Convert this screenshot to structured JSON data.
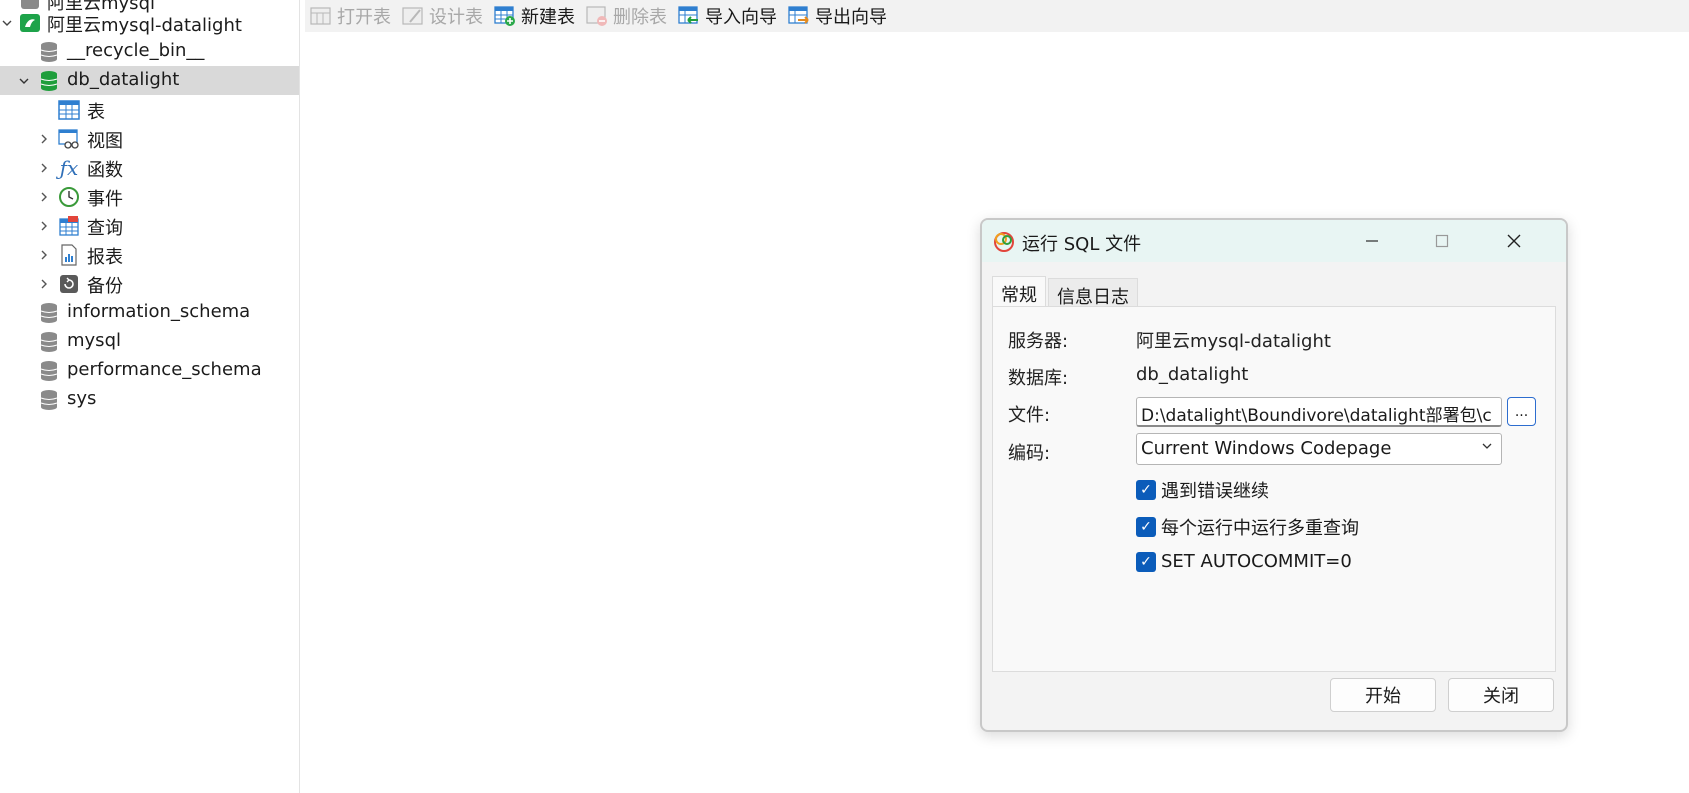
{
  "sidebar": {
    "connection_top_partial": "阿里云mysql",
    "connection": "阿里云mysql-datalight",
    "databases_before": [
      "__recycle_bin__"
    ],
    "selected_db": "db_datalight",
    "db_children": [
      "表",
      "视图",
      "函数",
      "事件",
      "查询",
      "报表",
      "备份"
    ],
    "databases_after": [
      "information_schema",
      "mysql",
      "performance_schema",
      "sys"
    ]
  },
  "toolbar": {
    "buttons": [
      {
        "label": "打开表",
        "enabled": false,
        "icon": "open-table-icon"
      },
      {
        "label": "设计表",
        "enabled": false,
        "icon": "design-table-icon"
      },
      {
        "label": "新建表",
        "enabled": true,
        "icon": "new-table-icon"
      },
      {
        "label": "删除表",
        "enabled": false,
        "icon": "delete-table-icon"
      },
      {
        "label": "导入向导",
        "enabled": true,
        "icon": "import-wizard-icon"
      },
      {
        "label": "导出向导",
        "enabled": true,
        "icon": "export-wizard-icon"
      }
    ]
  },
  "dialog": {
    "title": "运行 SQL 文件",
    "tabs": [
      "常规",
      "信息日志"
    ],
    "server_label": "服务器:",
    "server_value": "阿里云mysql-datalight",
    "database_label": "数据库:",
    "database_value": "db_datalight",
    "file_label": "文件:",
    "file_value": "D:\\datalight\\Boundivore\\datalight部署包\\c",
    "browse_label": "...",
    "encoding_label": "编码:",
    "encoding_value": "Current Windows Codepage",
    "checkboxes": [
      {
        "label": "遇到错误继续",
        "checked": true
      },
      {
        "label": "每个运行中运行多重查询",
        "checked": true
      },
      {
        "label": "SET AUTOCOMMIT=0",
        "checked": true
      }
    ],
    "start_button": "开始",
    "close_button": "关闭"
  },
  "colors": {
    "accent": "#0b5cba",
    "selected_row": "#d9d9d9",
    "titlebar": "#e8f5f3"
  }
}
